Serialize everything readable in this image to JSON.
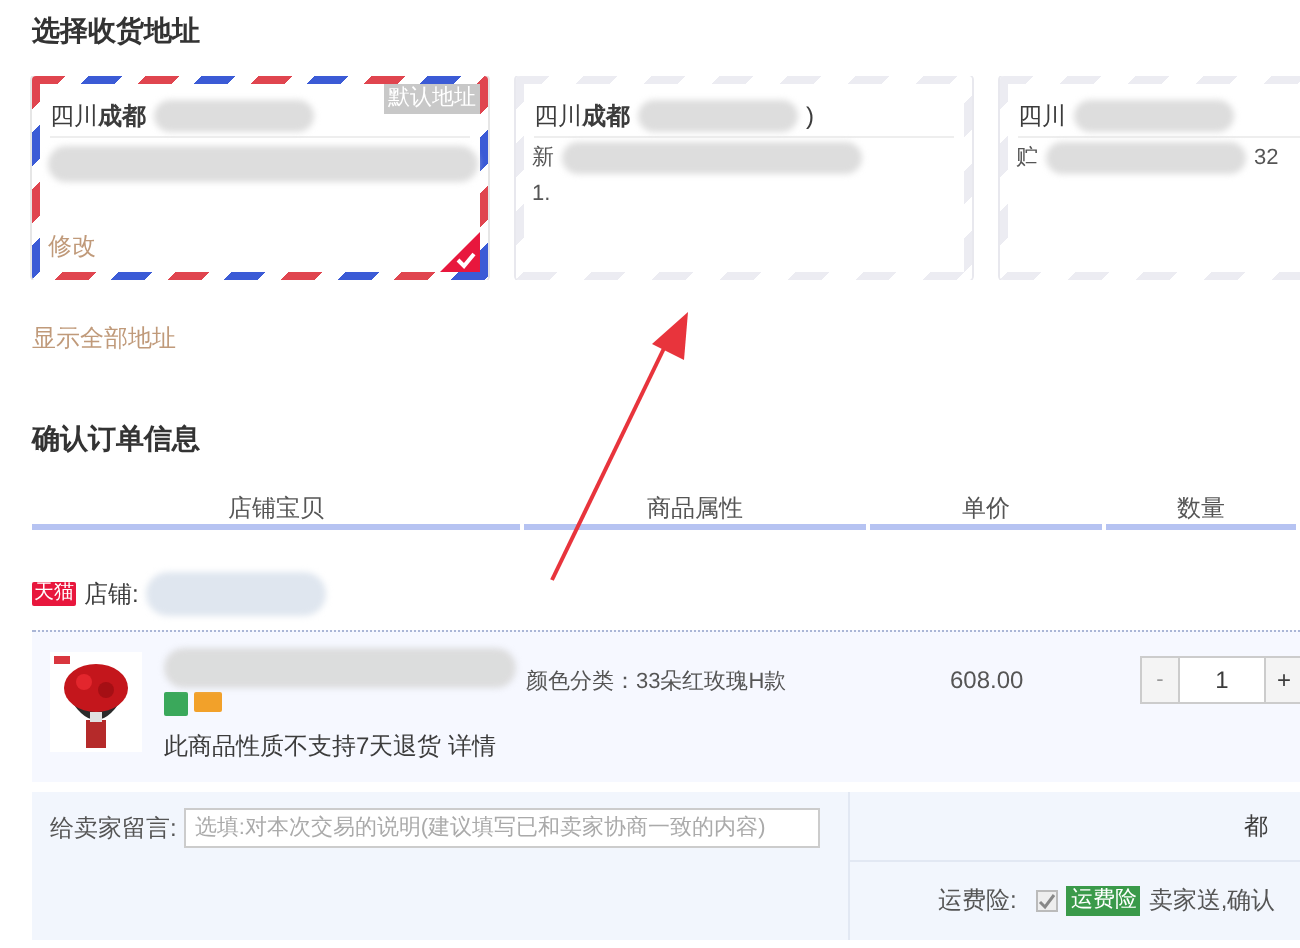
{
  "address_section": {
    "title": "选择收货地址",
    "show_all_link": "显示全部地址"
  },
  "addresses": [
    {
      "region": "四川**成都**",
      "selected": true,
      "default_badge": "默认地址",
      "edit_link": "修改"
    },
    {
      "region": "四川**成都**",
      "suffix": ")",
      "lines": [
        {
          "start": "新"
        },
        {
          "start": "1."
        }
      ],
      "selected": false
    },
    {
      "region": "四川",
      "lines": [
        {
          "start": "贮",
          "end": "32"
        }
      ],
      "selected": false
    }
  ],
  "order_section": {
    "title": "确认订单信息",
    "columns": [
      "店铺宝贝",
      "商品属性",
      "单价",
      "数量"
    ]
  },
  "shop": {
    "badge": "天猫",
    "label": "店铺:"
  },
  "item": {
    "attributes": "颜色分类：33朵红玫瑰H款",
    "price": "608.00",
    "quantity": "1",
    "decrement": "-",
    "increment": "+",
    "return_note": "此商品性质不支持7天退货",
    "details_link": "详情"
  },
  "message": {
    "label": "给卖家留言:",
    "placeholder": "选填:对本次交易的说明(建议填写已和卖家协商一致的内容)"
  },
  "right_fragment": "都",
  "shipping_insurance": {
    "label": "运费险:",
    "checked": true,
    "tag": "运费险",
    "text": "卖家送,确认"
  }
}
